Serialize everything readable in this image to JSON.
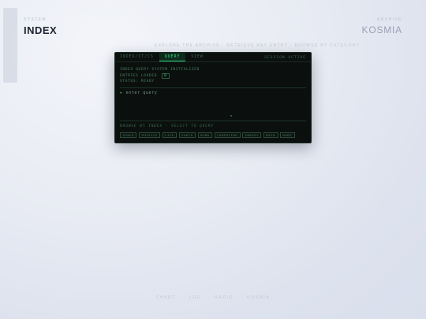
{
  "header": {
    "left_kicker": "SYSTEM",
    "title": "INDEX",
    "right_kicker": "ARCHIVE",
    "brand": "KOSMIA"
  },
  "subtitle": "EXPLORE THE ARCHIVE · RETRIEVE ANY ENTRY · BROWSE BY CATEGORY",
  "terminal": {
    "tabs": [
      {
        "label": "INDEX/IT/CS"
      },
      {
        "label": "QUERY"
      },
      {
        "label": "VIEW"
      }
    ],
    "active_tab": 1,
    "session_status": "SESSION ACTIVE",
    "system_lines": {
      "line1": "INDEX QUERY SYSTEM INITIALIZED",
      "line2_label": "ENTRIES LOADED",
      "line2_value": "0",
      "line3": "STATUS: READY"
    },
    "prompt": {
      "caret": "▸",
      "placeholder": "enter query",
      "value": ""
    },
    "browse_label": "BROWSE BY INDEX · SELECT TO QUERY",
    "chips": [
      "SPACE",
      "PHYSICS",
      "LIFE",
      "EARTH",
      "MIND",
      "COMPUTING",
      "ENERGY",
      "MATH",
      "MORE"
    ]
  },
  "footer_nav": [
    "CHART",
    "LOG",
    "RADIO",
    "KOSMIA"
  ],
  "colors": {
    "accent": "#39e585",
    "terminal_bg": "#0b100e"
  }
}
